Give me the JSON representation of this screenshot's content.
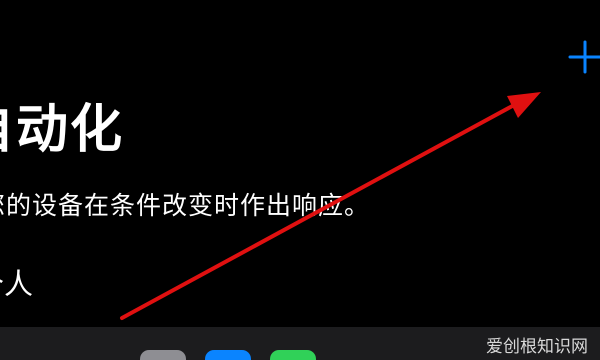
{
  "header": {
    "add_icon": "plus-icon",
    "accent_color": "#0a84ff"
  },
  "main": {
    "title": "自动化",
    "subtitle": "您的设备在条件改变时作出响应。",
    "section_label": "个人"
  },
  "annotation": {
    "arrow_color": "#e01010"
  },
  "dock": {
    "icons": [
      "app-icon-gray",
      "app-icon-blue",
      "app-icon-green"
    ]
  },
  "watermark": {
    "text": "爱创根知识网"
  }
}
